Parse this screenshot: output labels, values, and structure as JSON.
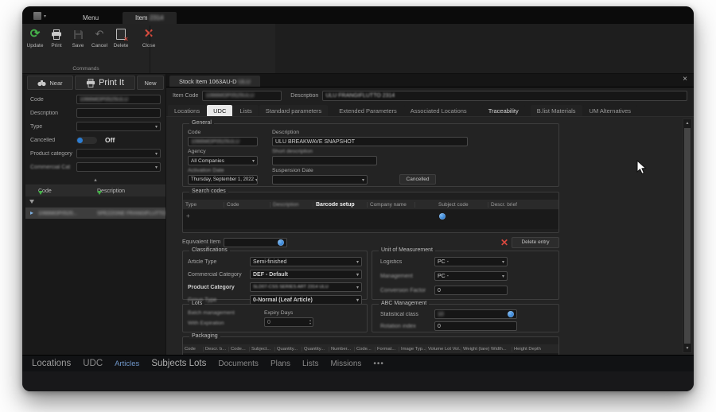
{
  "app": {
    "menu_tab": "Menu",
    "item_tab": "Item",
    "item_tab_suffix": "2314",
    "toolbar": [
      {
        "label": "Update"
      },
      {
        "label": "Print"
      },
      {
        "label": "Save"
      },
      {
        "label": "Cancel"
      },
      {
        "label": "Delete"
      },
      {
        "label": "Close"
      }
    ],
    "commands_label": "Commands"
  },
  "left_panel": {
    "buttons": {
      "near": "Near",
      "print": "Print It",
      "new": "New"
    },
    "fields": {
      "code_label": "Code",
      "code_value": "1066MOP0525ULU",
      "description_label": "Description",
      "type_label": "Type",
      "cancelled_label": "Cancelled",
      "cancelled_state": "Off",
      "product_category_label": "Product category",
      "commercial_cat_label": "Commercial Cat"
    },
    "grid": {
      "headers": [
        "Code",
        "Description"
      ],
      "row": {
        "code": "1066MOP0525...",
        "description": "SPEZZONE FRANGIFLUTTO ULU"
      }
    }
  },
  "main": {
    "doc_tab_title": "Stock Item 1063AU-D",
    "doc_tab_redacted": "ULU",
    "item_code_label": "Item Code",
    "item_code_value": "1066MOP0525ULU",
    "description_label": "Description",
    "description_value": "ULU FRANGIFLUTTO 2314",
    "tabs": [
      {
        "label": "Locations"
      },
      {
        "label": "UDC"
      },
      {
        "label": "Lists"
      },
      {
        "label": "Standard parameters"
      },
      {
        "label": "Extended Parameters"
      },
      {
        "label": "Associated Locations"
      },
      {
        "label": "Traceability"
      },
      {
        "label": "B.list Materials"
      },
      {
        "label": "UM Alternatives"
      }
    ],
    "general": {
      "title": "General",
      "code_label": "Code",
      "code_value": "1066MOP0525ULU",
      "description_label": "Description",
      "description_value": "ULU BREAKWAVE SNAPSHOT",
      "agency_label": "Agency",
      "agency_value": "All Companies",
      "short_description_label": "Short description",
      "activation_date_label": "Activation Date",
      "activation_date_value": "Thursday, September 1, 2022",
      "suspension_date_label": "Suspension Date",
      "cancelled_label": "Cancelled"
    },
    "search_codes": {
      "title": "Search codes",
      "headers": [
        "Type",
        "Code",
        "Description",
        "Barcode setup",
        "Company name",
        "Subject code",
        "Descr. brief"
      ],
      "equivalent_item_label": "Equivalent Item",
      "delete_entry_label": "Delete entry"
    },
    "classifications": {
      "title": "Classifications",
      "article_type_label": "Article Type",
      "article_type_value": "Semi-finished",
      "commercial_category_label": "Commercial Category",
      "commercial_category_value": "DEF - Default",
      "product_category_label": "Product Category",
      "product_category_value": "SLD07-CSS SERIES ART 2314 ULU",
      "group_type_label": "Group Type",
      "group_type_value": "0-Normal (Leaf Article)"
    },
    "uom": {
      "title": "Unit of Measurement",
      "logistics_label": "Logistics",
      "logistics_value": "PC -",
      "management_label": "Management",
      "management_value": "PC -",
      "conversion_factor_label": "Conversion Factor",
      "conversion_factor_value": "0"
    },
    "lots": {
      "title": "Lots",
      "batch_label": "Batch management",
      "expiry_label": "Expiry Days",
      "with_expiration_label": "With Expiration",
      "expiry_value": "0"
    },
    "abc": {
      "title": "ABC Management",
      "statistical_class_label": "Statistical class",
      "statistical_class_value": "10",
      "rotation_index_label": "Rotation index",
      "rotation_index_value": "0"
    },
    "packaging": {
      "title": "Packaging",
      "headers": [
        "Code",
        "Descr. b...",
        "Code...",
        "Subject...",
        "Quantity...",
        "Quantity...",
        "Number...",
        "Code...",
        "Format...",
        "Image Typ...",
        "Volume Lot Vol...",
        "Weight (tare) Width...",
        "Height Depth"
      ]
    }
  },
  "bottom_nav": {
    "items": [
      {
        "label": "Locations"
      },
      {
        "label": "UDC"
      },
      {
        "label": "Articles"
      },
      {
        "label": "Subjects Lots"
      },
      {
        "label": "Documents"
      },
      {
        "label": "Plans"
      },
      {
        "label": "Lists"
      },
      {
        "label": "Missions"
      },
      {
        "label": "•••"
      }
    ]
  },
  "colors": {
    "accent_green": "#46b04a",
    "accent_red": "#d24b3e",
    "accent_blue": "#2d7dd2",
    "active_tab_bg": "#e9e9e9"
  }
}
